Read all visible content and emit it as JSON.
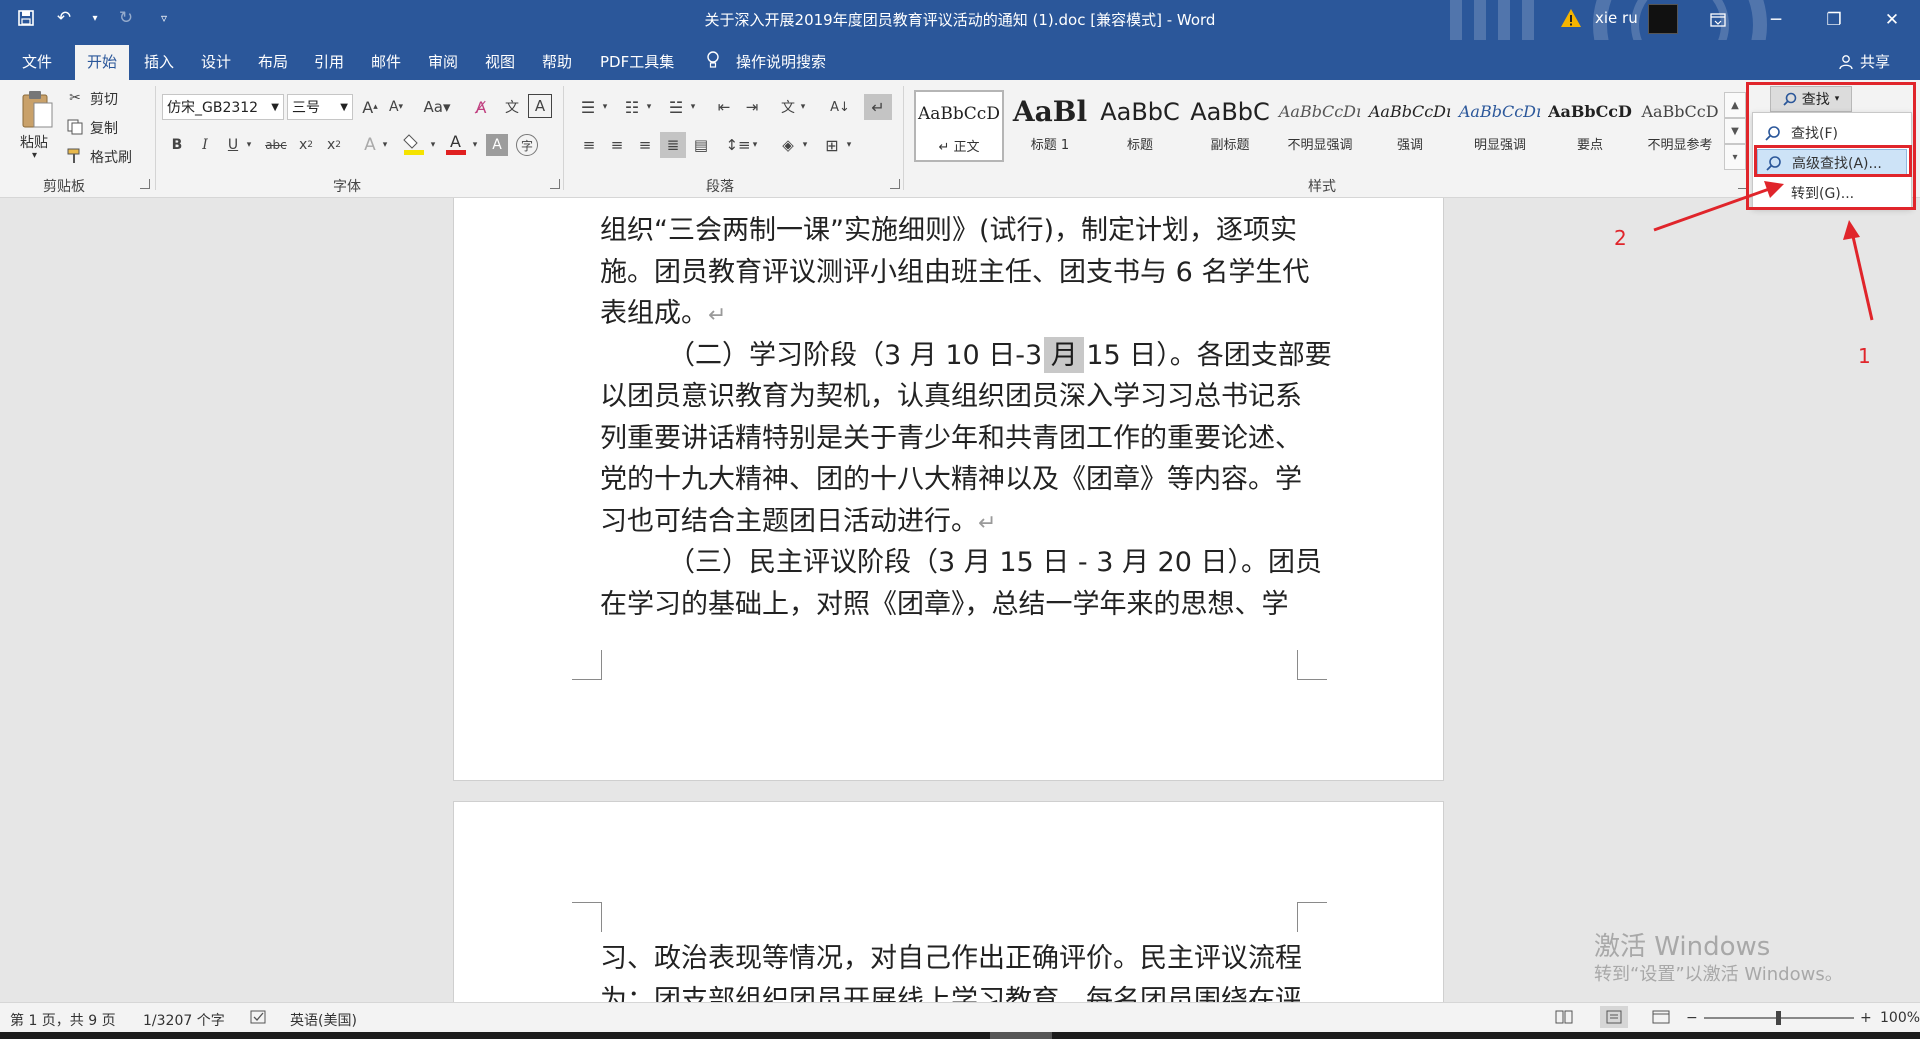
{
  "titlebar": {
    "title": "关于深入开展2019年度团员教育评议活动的通知 (1).doc [兼容模式] - Word",
    "user": "xie ru"
  },
  "tabs": [
    "文件",
    "开始",
    "插入",
    "设计",
    "布局",
    "引用",
    "邮件",
    "审阅",
    "视图",
    "帮助",
    "PDF工具集"
  ],
  "tell_me": "操作说明搜索",
  "share": "共享",
  "clipboard": {
    "paste": "粘贴",
    "cut": "剪切",
    "copy": "复制",
    "format_painter": "格式刷",
    "group": "剪贴板"
  },
  "font": {
    "name": "仿宋_GB2312",
    "size": "三号",
    "group": "字体"
  },
  "paragraph": {
    "group": "段落"
  },
  "styles": {
    "group": "样式",
    "items": [
      {
        "sample": "AaBbCcD",
        "name": "↵ 正文"
      },
      {
        "sample": "AaBl",
        "name": "标题 1"
      },
      {
        "sample": "AaBbC",
        "name": "标题"
      },
      {
        "sample": "AaBbC",
        "name": "副标题"
      },
      {
        "sample": "AaBbCcDı",
        "name": "不明显强调"
      },
      {
        "sample": "AaBbCcDı",
        "name": "强调"
      },
      {
        "sample": "AaBbCcDı",
        "name": "明显强调"
      },
      {
        "sample": "AaBbCcD",
        "name": "要点"
      },
      {
        "sample": "AaBbCcD",
        "name": "不明显参考"
      }
    ]
  },
  "find": {
    "button": "查找",
    "menu": [
      "查找(F)",
      "高级查找(A)...",
      "转到(G)..."
    ]
  },
  "document": {
    "lines_page1": [
      "组织“三会两制一课”实施细则》(试行)，制定计划，逐项实",
      "施。团员教育评议测评小组由班主任、团支书与 6 名学生代",
      "表组成。",
      "（二）学习阶段（3 月 10 日-3 月 15 日）。各团支部要",
      "以团员意识教育为契机，认真组织团员深入学习习总书记系",
      "列重要讲话精特别是关于青少年和共青团工作的重要论述、",
      "党的十九大精神、团的十八大精神以及《团章》等内容。学",
      "习也可结合主题团日活动进行。",
      "（三）民主评议阶段（3 月 15 日 - 3 月 20 日）。团员",
      "在学习的基础上，对照《团章》，总结一学年来的思想、学"
    ],
    "lines_page2": [
      "习、政治表现等情况，对自己作出正确评价。民主评议流程",
      "为：团支部组织团员开展线上学习教育，每名团员围绕在评"
    ]
  },
  "annotations": {
    "one": "1",
    "two": "2"
  },
  "watermark": {
    "line1": "激活 Windows",
    "line2": "转到“设置”以激活 Windows。"
  },
  "status": {
    "page": "第 1 页，共 9 页",
    "words": "1/3207 个字",
    "language": "英语(美国)",
    "zoom": "100%"
  },
  "colors": {
    "brand": "#2b579a",
    "annotation": "#e0252b",
    "font_color_bar": "#e02020",
    "highlight_bar": "#f5e300"
  }
}
